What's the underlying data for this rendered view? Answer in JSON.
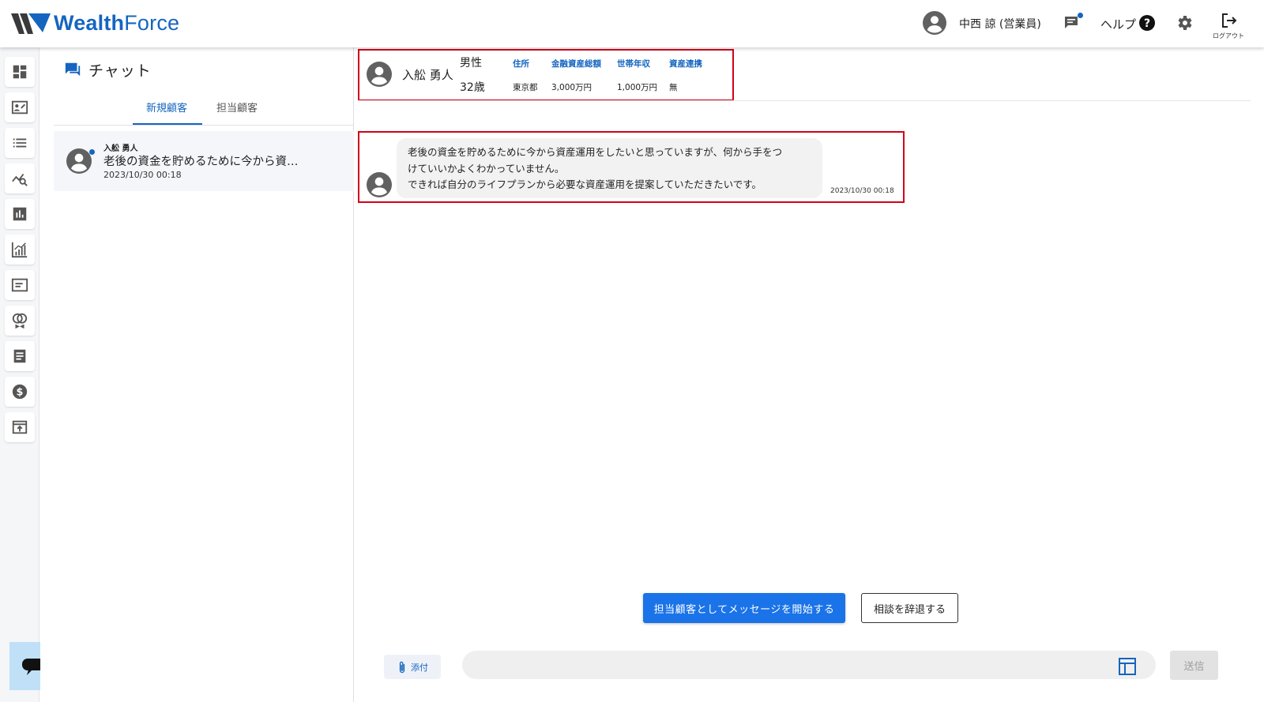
{
  "app": {
    "logo_text_bold": "Wealth",
    "logo_text_light": "Force",
    "brand_color": "#1565c0"
  },
  "header": {
    "user_name": "中西 諒 (営業員)",
    "help_label": "ヘルプ",
    "logout_label": "ログアウト",
    "icons": [
      "account-circle-icon",
      "chat-notification-icon",
      "help-icon",
      "gear-icon",
      "logout-icon"
    ]
  },
  "sidebar": {
    "items": [
      {
        "icon": "dashboard-icon"
      },
      {
        "icon": "contact-card-icon"
      },
      {
        "icon": "list-icon"
      },
      {
        "icon": "analytics-search-icon"
      },
      {
        "icon": "bar-chart-icon"
      },
      {
        "icon": "growth-chart-icon"
      },
      {
        "icon": "message-box-icon"
      },
      {
        "icon": "consultation-icon"
      },
      {
        "icon": "document-icon"
      },
      {
        "icon": "dollar-icon"
      },
      {
        "icon": "upload-window-icon"
      }
    ],
    "support_icon": "support-chat-icon"
  },
  "chat_panel": {
    "title": "チャット",
    "tabs": [
      {
        "label": "新規顧客",
        "active": true
      },
      {
        "label": "担当顧客",
        "active": false
      }
    ],
    "conversations": [
      {
        "name": "入舩 勇人",
        "preview": "老後の資金を貯めるために今から資…",
        "time": "2023/10/30 00:18",
        "unread": true
      }
    ]
  },
  "profile": {
    "name": "入舩 勇人",
    "gender": "男性",
    "age": "32歳",
    "columns": [
      {
        "head": "住所",
        "value": "東京都"
      },
      {
        "head": "金融資産総額",
        "value": "3,000万円"
      },
      {
        "head": "世帯年収",
        "value": "1,000万円"
      },
      {
        "head": "資産連携",
        "value": "無"
      }
    ]
  },
  "message": {
    "lines": [
      "老後の資金を貯めるために今から資産運用をしたいと思っていますが、何から手をつ",
      "けていいかよくわかっていません。",
      "できれば自分のライフプランから必要な資産運用を提案していただきたいです。"
    ],
    "time": "2023/10/30 00:18"
  },
  "actions": {
    "start_label": "担当顧客としてメッセージを開始する",
    "decline_label": "相談を辞退する"
  },
  "composer": {
    "attach_label": "添付",
    "input_value": "",
    "send_label": "送信"
  },
  "colors": {
    "accent": "#1a73e8",
    "highlight_border": "#d0021b"
  }
}
